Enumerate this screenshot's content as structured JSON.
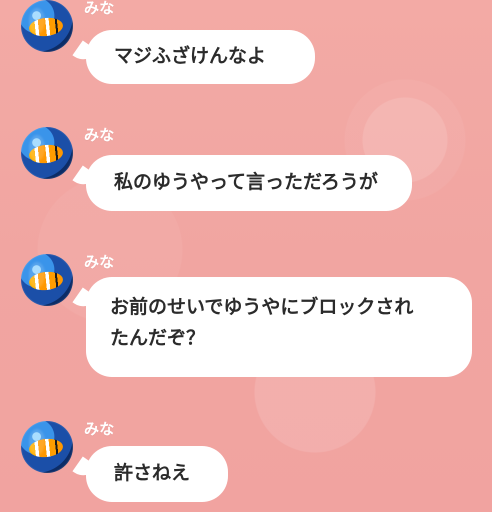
{
  "chat": {
    "messages": [
      {
        "sender": "みな",
        "text": "マジふざけんなよ"
      },
      {
        "sender": "みな",
        "text": "私のゆうやって言っただろうが"
      },
      {
        "sender": "みな",
        "text": "お前のせいでゆうやにブロックされ\nたんだぞ？"
      },
      {
        "sender": "みな",
        "text": "許さねえ"
      }
    ]
  },
  "avatar": {
    "icon": "fish-avatar"
  },
  "colors": {
    "background": "#f2a6a2",
    "bubble": "#ffffff",
    "text": "#2b2b2b",
    "sender": "#ffffff"
  }
}
